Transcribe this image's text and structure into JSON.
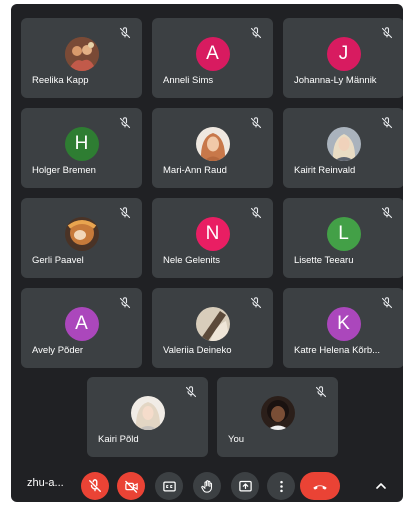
{
  "participants": [
    {
      "name": "Reelika Kapp",
      "avatar_type": "photo",
      "color": "#b5734a"
    },
    {
      "name": "Anneli Sims",
      "avatar_type": "initial",
      "initial": "A",
      "color": "#d81b60"
    },
    {
      "name": "Johanna-Ly Männik",
      "avatar_type": "initial",
      "initial": "J",
      "color": "#d81b60"
    },
    {
      "name": "Holger Bremen",
      "avatar_type": "initial",
      "initial": "H",
      "color": "#2e7d32"
    },
    {
      "name": "Mari-Ann Raud",
      "avatar_type": "photo",
      "color": "#e4a46e"
    },
    {
      "name": "Kairit Reinvald",
      "avatar_type": "photo",
      "color": "#9aa4b1"
    },
    {
      "name": "Gerli Paavel",
      "avatar_type": "photo",
      "color": "#8a5a2e"
    },
    {
      "name": "Nele Gelenits",
      "avatar_type": "initial",
      "initial": "N",
      "color": "#e91e63"
    },
    {
      "name": "Lisette Teearu",
      "avatar_type": "initial",
      "initial": "L",
      "color": "#43a047"
    },
    {
      "name": "Avely Põder",
      "avatar_type": "initial",
      "initial": "A",
      "color": "#ab47bc"
    },
    {
      "name": "Valeriia Deineko",
      "avatar_type": "photo",
      "color": "#c9b79c"
    },
    {
      "name": "Katre Helena Kõrb...",
      "avatar_type": "initial",
      "initial": "K",
      "color": "#ab47bc"
    },
    {
      "name": "Kairi Põld",
      "avatar_type": "photo",
      "color": "#e6ddd2"
    },
    {
      "name": "You",
      "avatar_type": "photo",
      "color": "#3a2a22"
    }
  ],
  "icons": {
    "tile_status": "mic-off-icon",
    "mic": "mic-off-icon",
    "camera": "camera-off-icon",
    "captions": "captions-icon",
    "raise_hand": "hand-icon",
    "present": "present-icon",
    "more": "more-vert-icon",
    "leave": "call-end-icon",
    "expand": "chevron-up-icon"
  },
  "controls": {
    "meeting_code": "zhu-a..."
  },
  "colors": {
    "background": "#202124",
    "tile": "#3c4043",
    "danger": "#ea4335"
  }
}
